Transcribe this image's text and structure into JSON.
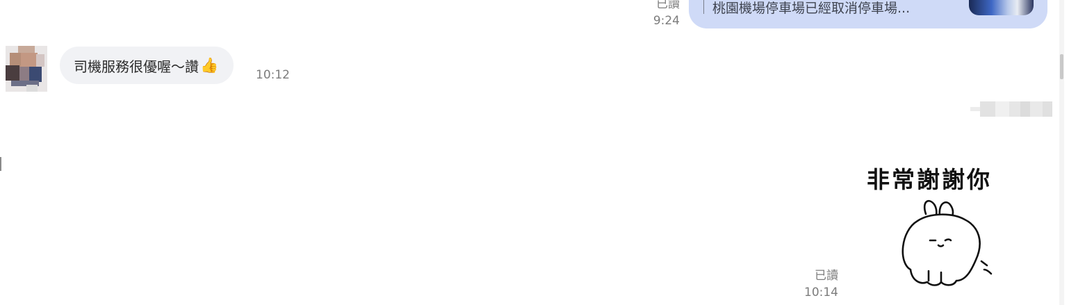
{
  "chat": {
    "messages": [
      {
        "direction": "sent",
        "type": "reply-preview",
        "preview_text": "桃園機場停車場已經取消停車場...",
        "status": "已讀",
        "time": "9:24"
      },
      {
        "direction": "received",
        "type": "text",
        "text": "司機服務很優喔～讚",
        "emoji": "👍",
        "time": "10:12"
      },
      {
        "direction": "sent",
        "type": "sticker",
        "sticker_text": "非常謝謝你",
        "sticker_icon": "bunny-sticker-icon",
        "status": "已讀",
        "time": "10:14"
      }
    ]
  },
  "colors": {
    "sent_bubble": "#cfdaf7",
    "received_bubble": "#f1f2f5",
    "meta_text": "#7c7c7c"
  }
}
